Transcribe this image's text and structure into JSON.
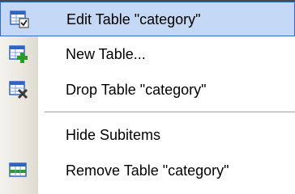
{
  "menu": {
    "items": [
      {
        "label": "Edit Table \"category\"",
        "icon": "edit-table-icon",
        "hover": true
      },
      {
        "label": "New Table...",
        "icon": "new-table-icon"
      },
      {
        "label": "Drop Table \"category\"",
        "icon": "drop-table-icon"
      },
      {
        "label": "Hide Subitems"
      },
      {
        "label": "Remove Table \"category\"",
        "icon": "remove-table-icon"
      }
    ]
  },
  "colors": {
    "hover_fill": "#c4d7f4",
    "hover_border": "#316ac5",
    "table_blue": "#2f63c7",
    "plus_green": "#2b9a2b"
  }
}
